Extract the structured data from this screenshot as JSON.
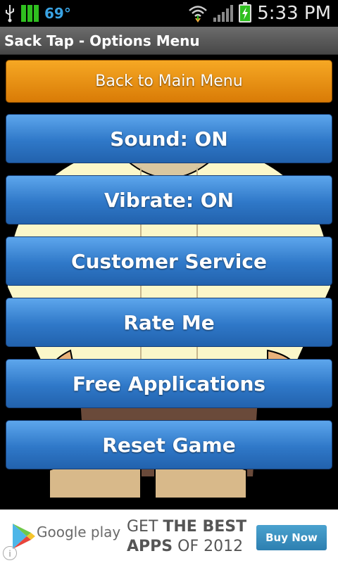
{
  "statusbar": {
    "temperature": "69°",
    "time": "5:33 PM",
    "icons": [
      "usb-icon",
      "wifi-icon",
      "signal-icon",
      "battery-charging-icon"
    ]
  },
  "app": {
    "title": "Sack Tap - Options Menu"
  },
  "menu": {
    "back_label": "Back to Main Menu",
    "sound_label": "Sound: ON",
    "vibrate_label": "Vibrate: ON",
    "customer_service_label": "Customer Service",
    "rate_label": "Rate Me",
    "free_apps_label": "Free Applications",
    "reset_label": "Reset Game"
  },
  "ad": {
    "brand": "Google play",
    "line1_light": "GET",
    "line1_bold": "THE BEST",
    "line2_bold": "APPS",
    "line2_light": "OF 2012",
    "button_label": "Buy Now",
    "info_symbol": "i"
  },
  "colors": {
    "accent_orange": "#e38f12",
    "button_blue": "#2f78c8",
    "titlebar_gray": "#555555"
  }
}
